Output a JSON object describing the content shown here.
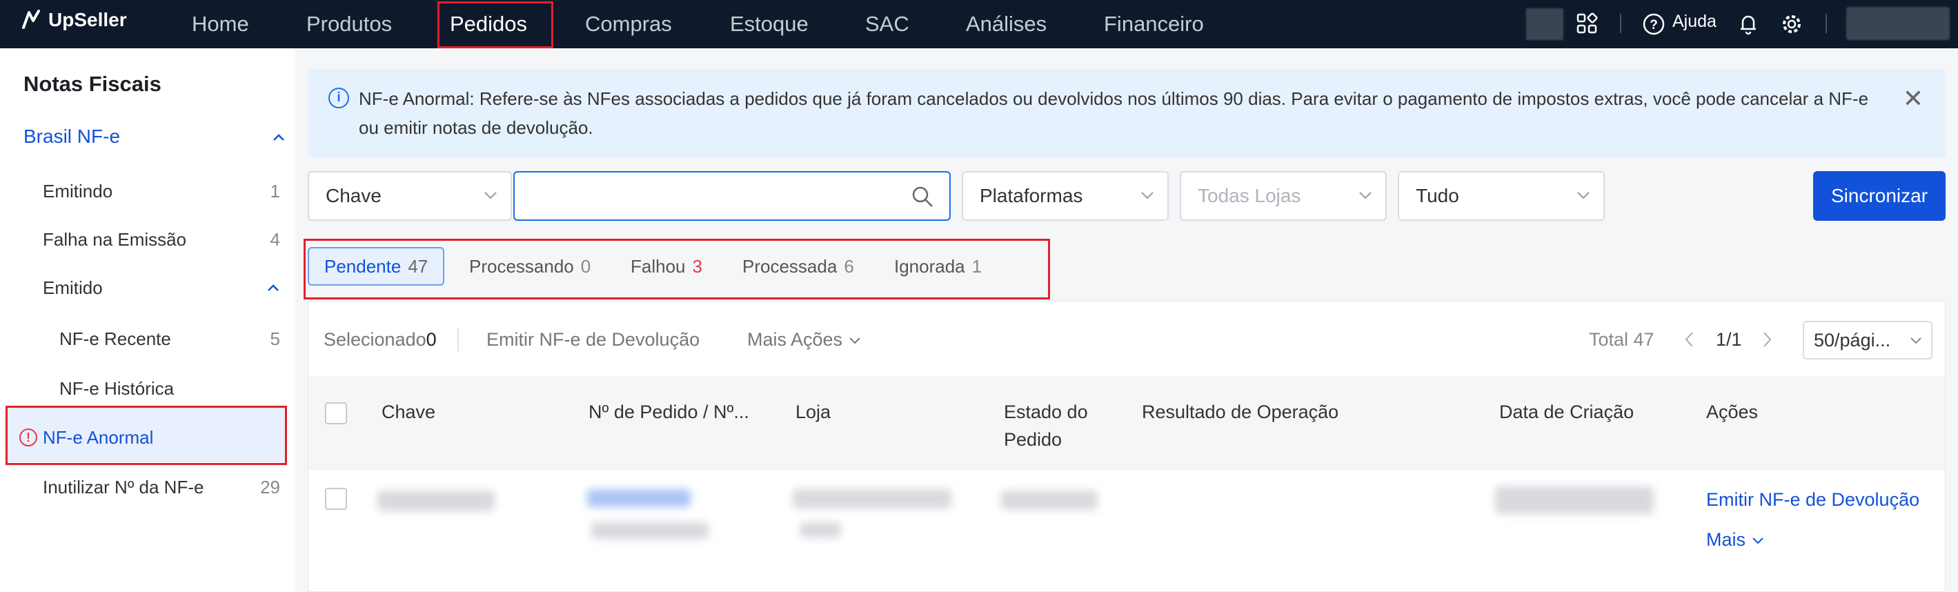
{
  "app": {
    "brand": "UpSeller",
    "nav": [
      "Home",
      "Produtos",
      "Pedidos",
      "Compras",
      "Estoque",
      "SAC",
      "Análises",
      "Financeiro"
    ],
    "active_nav": "Pedidos",
    "help_label": "Ajuda"
  },
  "sidebar": {
    "title": "Notas Fiscais",
    "section": "Brasil NF-e",
    "items": [
      {
        "label": "Emitindo",
        "count": "1"
      },
      {
        "label": "Falha na Emissão",
        "count": "4"
      },
      {
        "label": "Emitido",
        "count": ""
      },
      {
        "label": "NF-e Recente",
        "count": "5"
      },
      {
        "label": "NF-e Histórica",
        "count": ""
      },
      {
        "label": "NF-e Anormal",
        "count": ""
      },
      {
        "label": "Inutilizar Nº da NF-e",
        "count": "29"
      }
    ]
  },
  "banner": {
    "text": "NF-e Anormal: Refere-se às NFes associadas a pedidos que já foram cancelados ou devolvidos nos últimos 90 dias. Para evitar o pagamento de impostos extras, você pode cancelar a NF-e ou emitir notas de devolução."
  },
  "filters": {
    "key_select": "Chave",
    "search_value": "",
    "platform_select": "Plataformas",
    "stores_placeholder": "Todas Lojas",
    "status_select": "Tudo",
    "sync_button": "Sincronizar"
  },
  "tabs": [
    {
      "label": "Pendente",
      "count": "47"
    },
    {
      "label": "Processando",
      "count": "0"
    },
    {
      "label": "Falhou",
      "count": "3"
    },
    {
      "label": "Processada",
      "count": "6"
    },
    {
      "label": "Ignorada",
      "count": "1"
    }
  ],
  "toolbar": {
    "selected_label": "Selecionado",
    "selected_count": "0",
    "issue_return": "Emitir NF-e de Devolução",
    "more_actions": "Mais Ações",
    "total": "Total 47",
    "page": "1/1",
    "per_page": "50/pági..."
  },
  "table": {
    "columns": [
      "Chave",
      "Nº de Pedido / Nº...",
      "Loja",
      "Estado do Pedido",
      "Resultado de Operação",
      "Data de Criação",
      "Ações"
    ],
    "row_actions": {
      "primary": "Emitir NF-e de Devolução",
      "more": "Mais"
    }
  },
  "colors": {
    "nav_bg": "#0e1a2b",
    "accent": "#1152d8",
    "highlight_border": "#e0212d",
    "alert": "#e43a4b"
  }
}
